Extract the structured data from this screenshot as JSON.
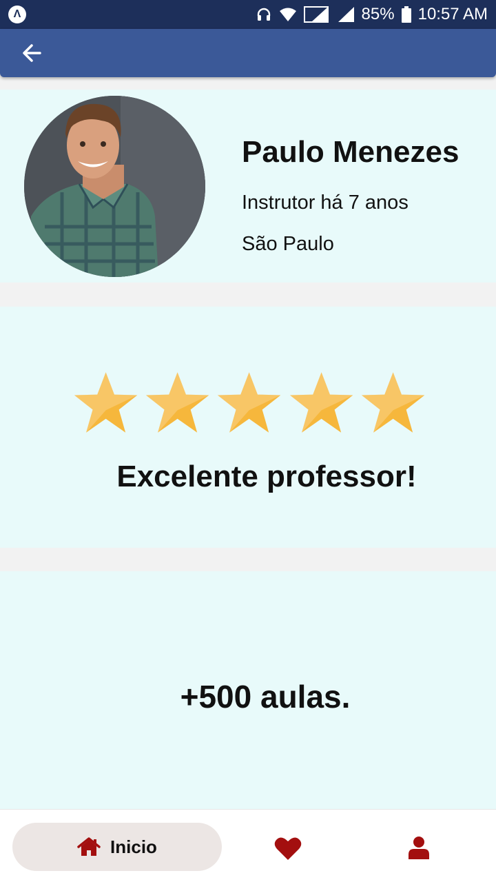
{
  "status_bar": {
    "battery": "85%",
    "time": "10:57 AM"
  },
  "profile": {
    "name": "Paulo Menezes",
    "experience": "Instrutor há 7 anos",
    "city": "São Paulo"
  },
  "rating": {
    "stars": 5,
    "max_stars": 5,
    "review": "Excelente professor!"
  },
  "lessons": {
    "text": "+500 aulas."
  },
  "bottom_nav": {
    "home_label": "Inicio"
  },
  "colors": {
    "status_bar": "#1d2f5a",
    "app_bar": "#3b5998",
    "card_background": "#e8fafa",
    "star": "#f6b73c",
    "nav_icon": "#a30f0f"
  }
}
